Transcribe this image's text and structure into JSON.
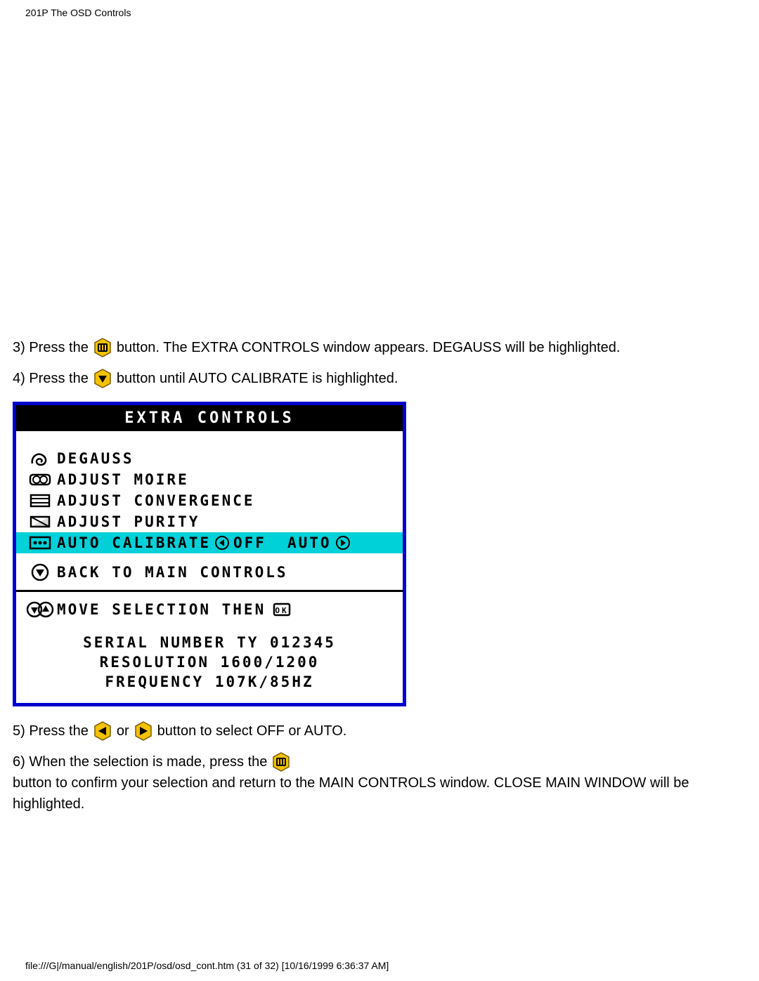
{
  "header": "201P The OSD Controls",
  "step3": {
    "a": "3) Press the ",
    "b": " button. The EXTRA CONTROLS window appears. DEGAUSS will be highlighted."
  },
  "step4": {
    "a": "4) Press the ",
    "b": " button until AUTO CALIBRATE is highlighted."
  },
  "osd": {
    "title": "EXTRA  CONTROLS",
    "items": [
      {
        "label": "DEGAUSS"
      },
      {
        "label": "ADJUST MOIRE"
      },
      {
        "label": "ADJUST CONVERGENCE"
      },
      {
        "label": "ADJUST PURITY"
      },
      {
        "label": "AUTO CALIBRATE",
        "opt_left": "OFF",
        "opt_right": "AUTO"
      }
    ],
    "back": "BACK TO MAIN CONTROLS",
    "hint": "MOVE SELECTION THEN",
    "serial": "SERIAL NUMBER TY 012345",
    "resolution": "RESOLUTION 1600/1200",
    "frequency": "FREQUENCY 107K/85HZ"
  },
  "step5": {
    "a": "5) Press the ",
    "b": " or ",
    "c": " button to select OFF or AUTO."
  },
  "step6": {
    "a": "6) When the selection is made, press the ",
    "b": " button to confirm your selection and return to the MAIN CONTROLS window. CLOSE MAIN WINDOW will be highlighted."
  },
  "footer": "file:///G|/manual/english/201P/osd/osd_cont.htm (31 of 32) [10/16/1999 6:36:37 AM]"
}
